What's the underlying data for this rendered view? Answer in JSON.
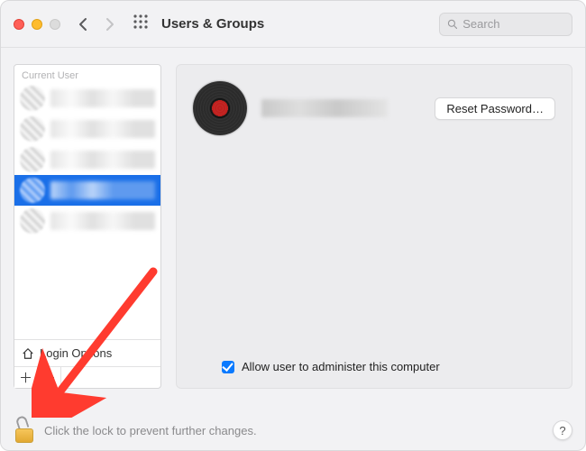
{
  "window": {
    "title": "Users & Groups"
  },
  "search": {
    "placeholder": "Search"
  },
  "sidebar": {
    "section_label": "Current User",
    "login_options_label": "Login Options",
    "add_symbol": "＋",
    "remove_symbol": "－"
  },
  "detail": {
    "reset_password_label": "Reset Password…",
    "admin_checkbox_label": "Allow user to administer this computer",
    "admin_checked": true
  },
  "footer": {
    "lock_text": "Click the lock to prevent further changes.",
    "help_symbol": "?"
  }
}
